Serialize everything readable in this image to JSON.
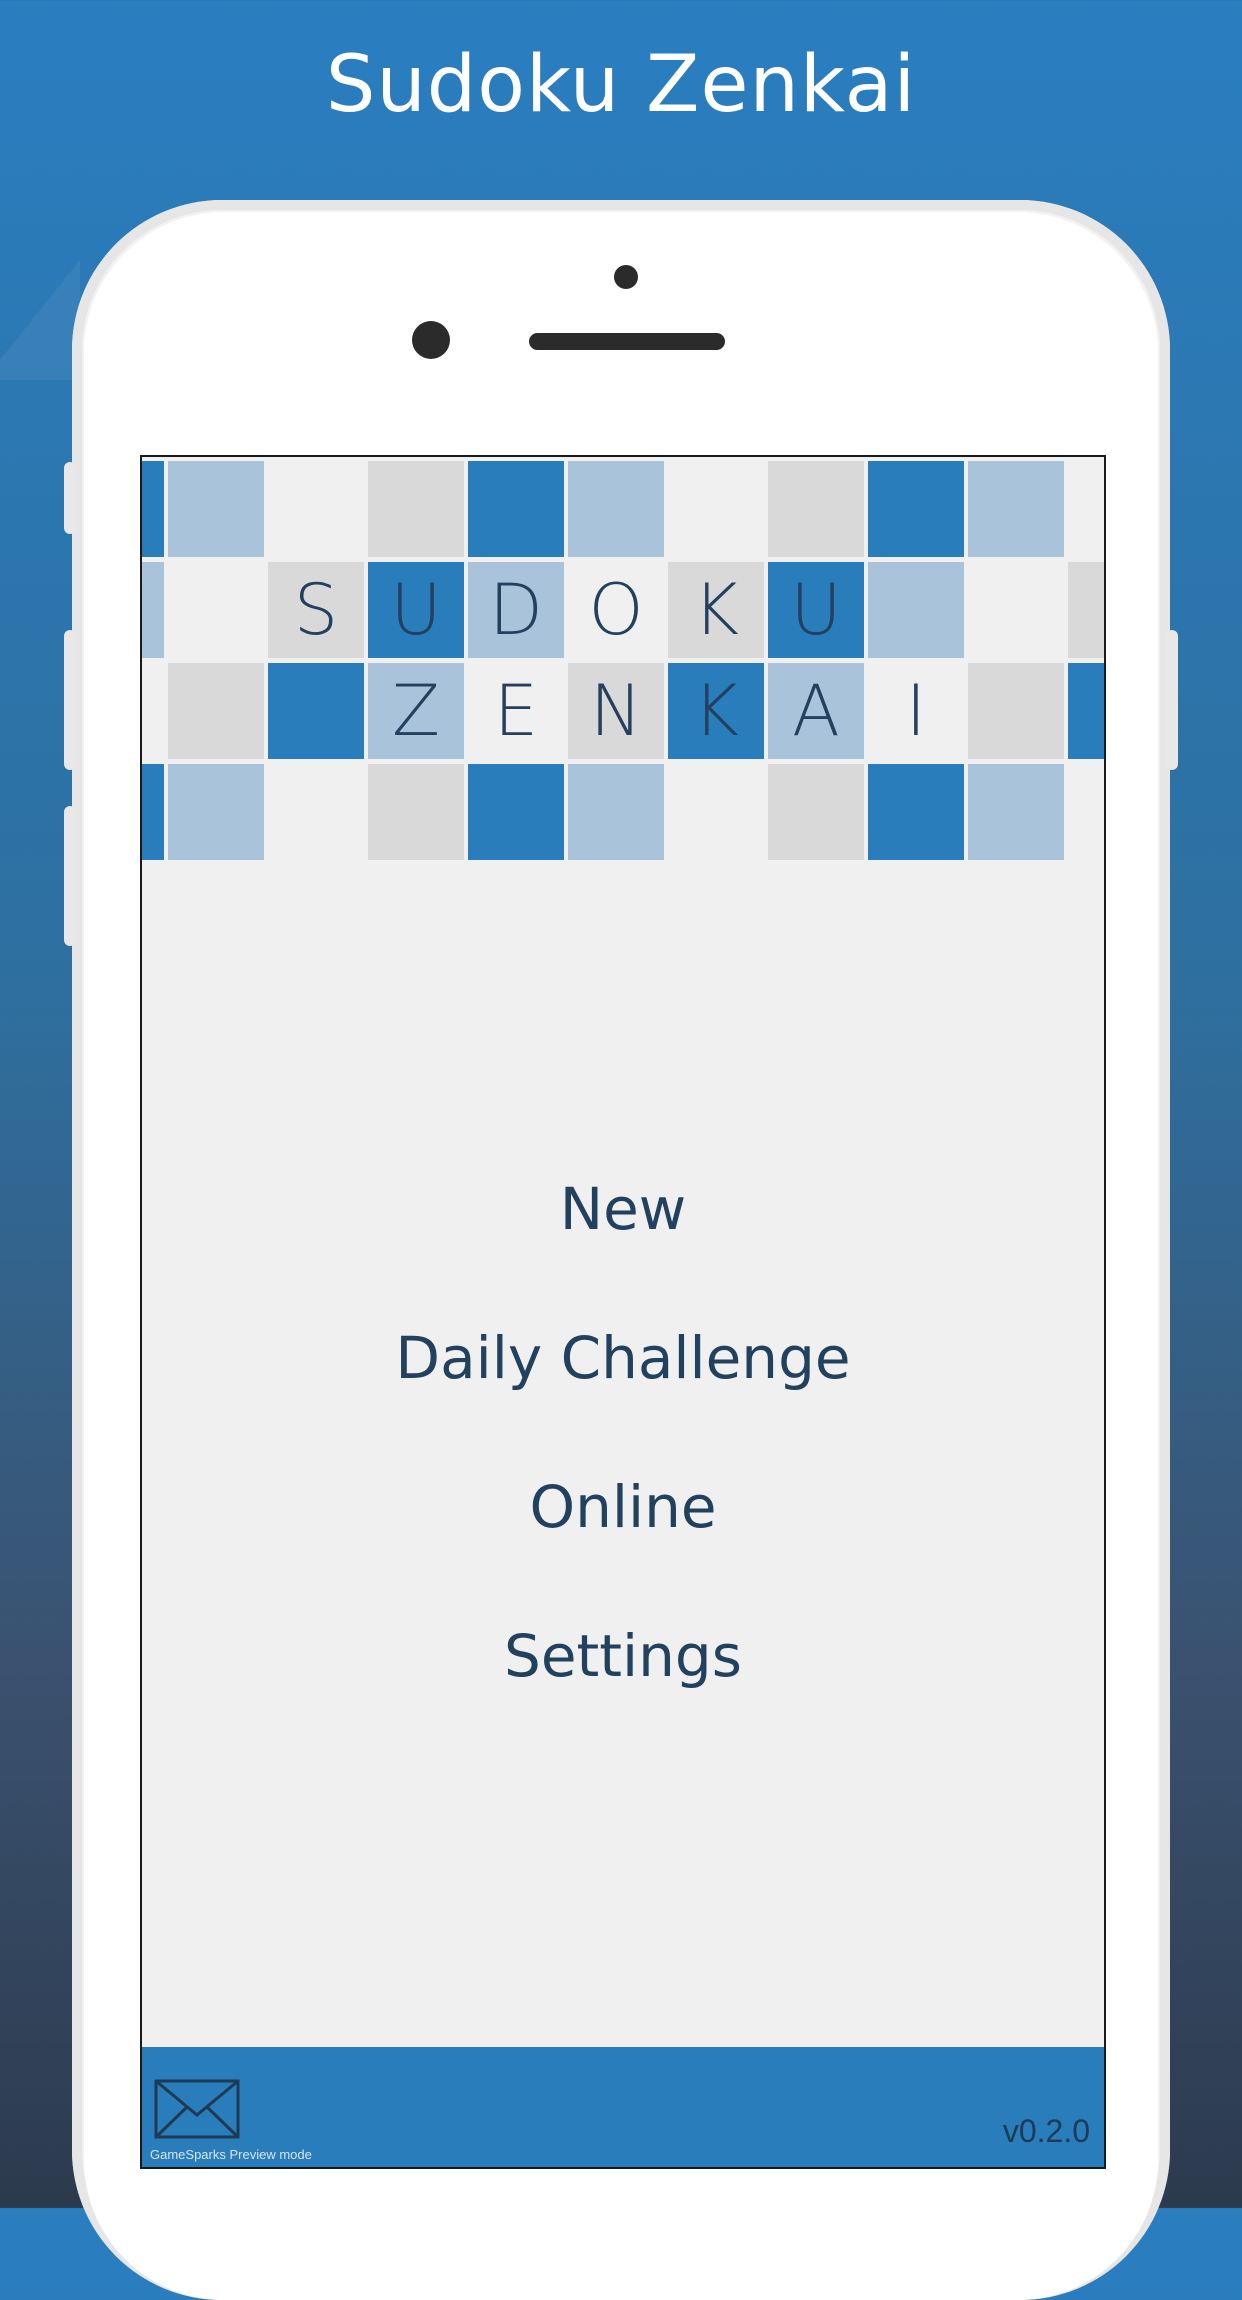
{
  "header": {
    "title": "Sudoku Zenkai"
  },
  "logo": {
    "word1": [
      "S",
      "U",
      "D",
      "O",
      "K",
      "U"
    ],
    "word2": [
      "Z",
      "E",
      "N",
      "K",
      "A",
      "I"
    ]
  },
  "menu": {
    "items": [
      {
        "label": "New"
      },
      {
        "label": "Daily Challenge"
      },
      {
        "label": "Online"
      },
      {
        "label": "Settings"
      }
    ]
  },
  "footer": {
    "mail_icon": "envelope-icon",
    "preview_text": "GameSparks Preview mode",
    "version": "v0.2.0"
  },
  "colors": {
    "accent": "#2a7dbb",
    "light_tile": "#a9c4da",
    "gray_tile": "#d9d9d9",
    "text_dark": "#21415f"
  }
}
